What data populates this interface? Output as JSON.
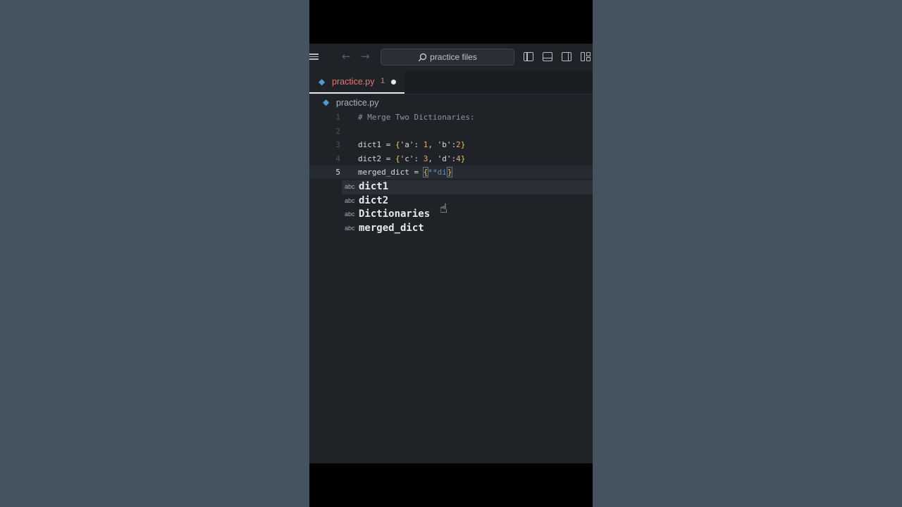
{
  "search": {
    "label": "practice files"
  },
  "tab": {
    "label": "practice.py",
    "problems": "1"
  },
  "breadcrumb": {
    "label": "practice.py"
  },
  "code": {
    "lines": [
      {
        "num": "1",
        "text": "# Merge Two Dictionaries:"
      },
      {
        "num": "2",
        "text": ""
      },
      {
        "num": "3",
        "text": "dict1 = {'a': 1, 'b':2}"
      },
      {
        "num": "4",
        "text": "dict2 = {'c': 3, 'd':4}"
      },
      {
        "num": "5",
        "text": "merged_dict = {**di}"
      }
    ]
  },
  "suggestions": [
    {
      "kind": "abc",
      "label": "dict1"
    },
    {
      "kind": "abc",
      "label": "dict2"
    },
    {
      "kind": "abc",
      "label": "Dictionaries"
    },
    {
      "kind": "abc",
      "label": "merged_dict"
    }
  ],
  "colors": {
    "accent_tab": "#e8766c",
    "python_icon": "#4a9ec9",
    "number": "#e8a86a",
    "bracket": "#e6c76a"
  },
  "icons": [
    "menu-icon",
    "back-arrow-icon",
    "forward-arrow-icon",
    "search-icon",
    "layout-left-icon",
    "layout-bottom-icon",
    "layout-right-icon",
    "layout-custom-icon",
    "python-file-icon",
    "hand-pointer-icon"
  ]
}
